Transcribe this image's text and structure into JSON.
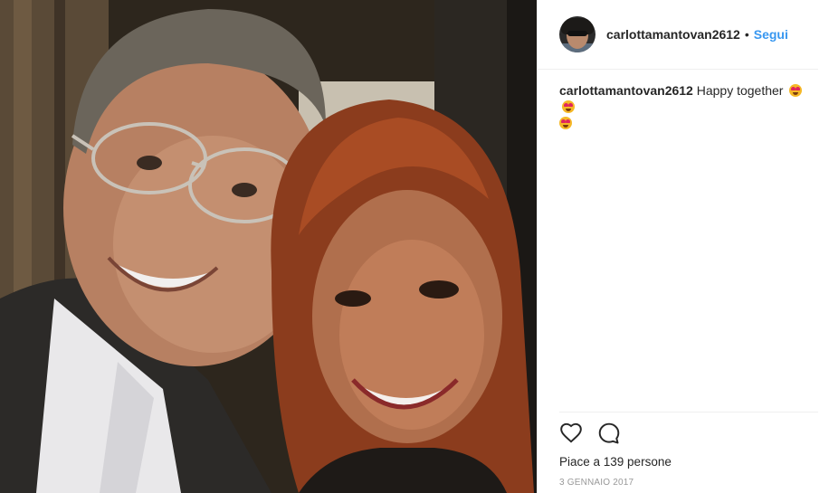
{
  "post": {
    "photo_alt": "Selfie of a smiling man with glasses and a smiling woman with long auburn hair",
    "header": {
      "username": "carlottamantovan2612",
      "separator": "•",
      "follow_label": "Segui"
    },
    "caption": {
      "username": "carlottamantovan2612",
      "text": "Happy together",
      "emojis": [
        "heart-eyes-emoji",
        "heart-eyes-emoji",
        "heart-eyes-emoji"
      ]
    },
    "actions": {
      "like_icon": "heart-outline-icon",
      "comment_icon": "comment-bubble-icon"
    },
    "likes_text": "Piace a 139 persone",
    "date": "3 GENNAIO 2017",
    "colors": {
      "link_blue": "#3897f0",
      "text": "#262626",
      "muted": "#999999",
      "divider": "#efefef"
    }
  }
}
